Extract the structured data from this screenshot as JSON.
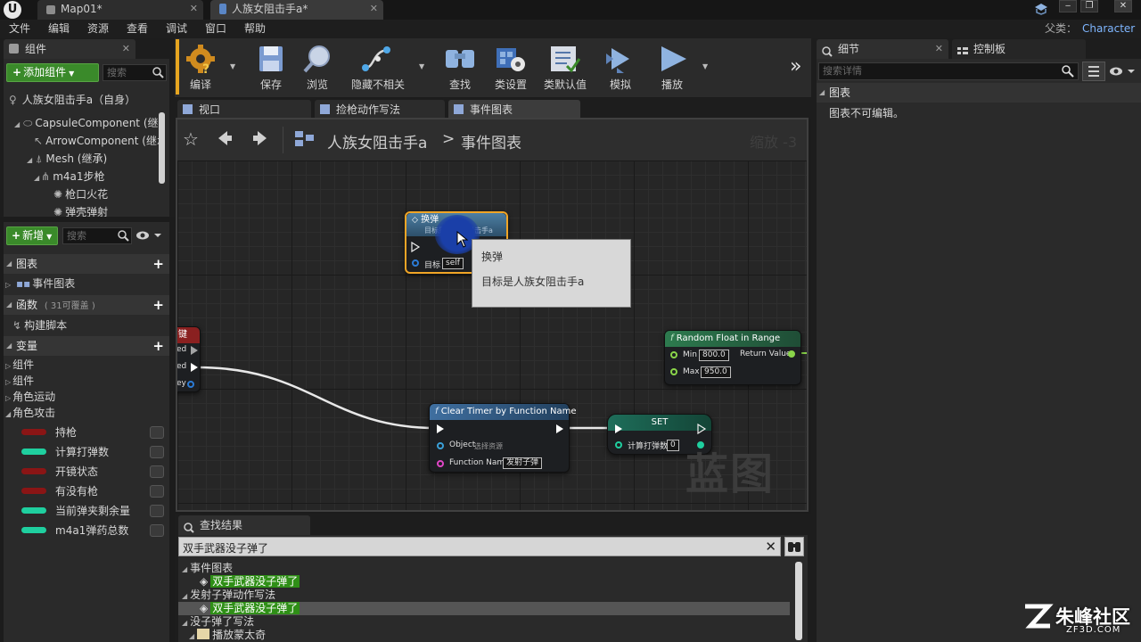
{
  "titlebar": {
    "tabs": [
      {
        "label": "Map01*"
      },
      {
        "label": "人族女阻击手a*"
      }
    ],
    "window_buttons": [
      "‒",
      "❐",
      "✕"
    ]
  },
  "menubar": {
    "items": [
      "文件",
      "编辑",
      "资源",
      "查看",
      "调试",
      "窗口",
      "帮助"
    ],
    "parent_class_label": "父类：",
    "parent_class_value": "Character"
  },
  "components_panel": {
    "tab_label": "组件",
    "add_button": "添加组件",
    "search_placeholder": "搜索",
    "tree": [
      "人族女阻击手a（自身）",
      "CapsuleComponent (继承",
      "ArrowComponent (继承",
      "Mesh (继承)",
      "m4a1步枪",
      "枪口火花",
      "弹壳弹射"
    ]
  },
  "my_blueprint": {
    "new_button": "新增",
    "search_placeholder": "搜索",
    "sections": {
      "graphs": "图表",
      "event_graph": "事件图表",
      "functions": "函数",
      "functions_note": "( 31可覆盖 )",
      "construction_script": "构建脚本",
      "variables": "变量"
    },
    "variable_categories": [
      "组件",
      "组件",
      "角色运动",
      "角色攻击"
    ],
    "variables": [
      {
        "name": "持枪",
        "color": "#8a1515"
      },
      {
        "name": "计算打弹数",
        "color": "#1fcf9f"
      },
      {
        "name": "开镜状态",
        "color": "#8a1515"
      },
      {
        "name": "有没有枪",
        "color": "#8a1515"
      },
      {
        "name": "当前弹夹剩余量",
        "color": "#1fcf9f"
      },
      {
        "name": "m4a1弹药总数",
        "color": "#1fcf9f"
      }
    ]
  },
  "toolbar": {
    "buttons": [
      {
        "label": "编译",
        "icon": "compile-icon"
      },
      {
        "label": "保存",
        "icon": "save-icon"
      },
      {
        "label": "浏览",
        "icon": "browse-icon"
      },
      {
        "label": "隐藏不相关",
        "icon": "hide-unrelated-icon"
      },
      {
        "label": "查找",
        "icon": "find-icon"
      },
      {
        "label": "类设置",
        "icon": "class-settings-icon"
      },
      {
        "label": "类默认值",
        "icon": "class-defaults-icon"
      },
      {
        "label": "模拟",
        "icon": "simulate-icon"
      },
      {
        "label": "播放",
        "icon": "play-icon"
      }
    ],
    "overflow": "»"
  },
  "editor_tabs": [
    {
      "label": "视口"
    },
    {
      "label": "捡枪动作写法"
    },
    {
      "label": "事件图表"
    }
  ],
  "breadcrumb": {
    "blueprint": "人族女阻击手a",
    "separator": ">",
    "graph": "事件图表",
    "zoom": "缩放 -3"
  },
  "graph": {
    "watermark": "蓝图",
    "node_swap": {
      "title": "换弹",
      "subtitle": "目标是人族女阻击手a",
      "pin_target": "目标",
      "pin_target_value": "self"
    },
    "tooltip": {
      "title": "换弹",
      "body": "目标是人族女阻击手a"
    },
    "node_left": {
      "title": "键",
      "pins": [
        "ed",
        "ed",
        "ey"
      ]
    },
    "node_random": {
      "title": "Random Float in Range",
      "min_label": "Min",
      "min_value": "800.0",
      "max_label": "Max",
      "max_value": "950.0",
      "return_label": "Return Value"
    },
    "node_clear_timer": {
      "title": "Clear Timer by Function Name",
      "object_label": "Object",
      "object_value": "选择资源",
      "function_label": "Function Name",
      "function_value": "发射子弹"
    },
    "node_set": {
      "title": "SET",
      "var_label": "计算打弹数",
      "var_value": "0"
    }
  },
  "details_panel": {
    "tab_details": "细节",
    "tab_palette": "控制板",
    "search_placeholder": "搜索详情",
    "section": "图表",
    "message": "图表不可编辑。"
  },
  "find_results": {
    "tab_label": "查找结果",
    "query": "双手武器没子弹了",
    "groups": [
      {
        "label": "事件图表",
        "item": "双手武器没子弹了"
      },
      {
        "label": "发射子弹动作写法",
        "item": "双手武器没子弹了"
      },
      {
        "label": "没子弹了写法",
        "item": "播放蒙太奇"
      }
    ]
  },
  "brand": {
    "name": "朱峰社区",
    "url": "ZF3D.COM"
  }
}
